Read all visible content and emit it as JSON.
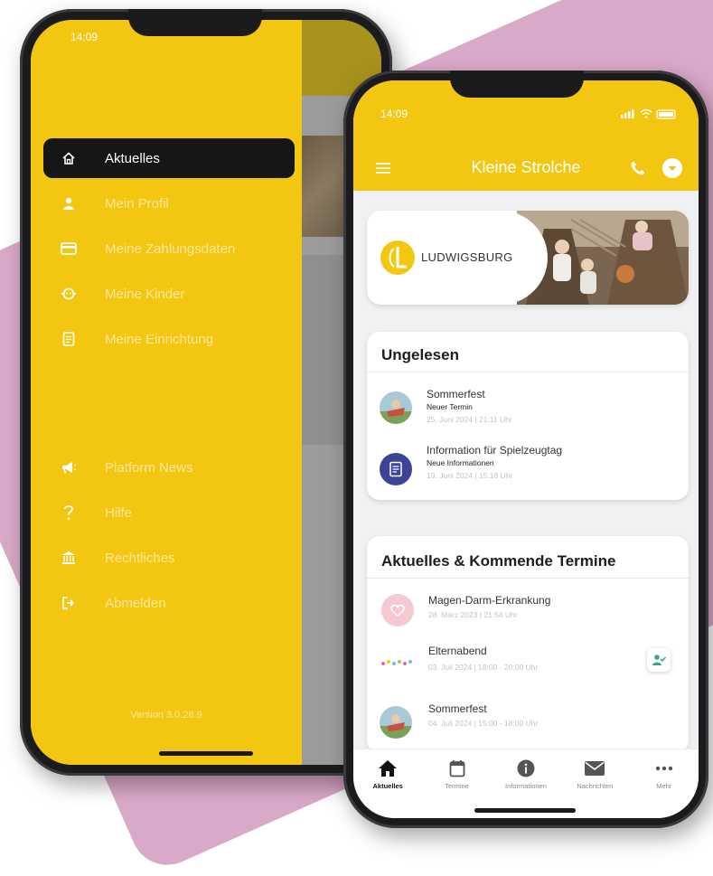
{
  "back_phone": {
    "status_time": "14:09",
    "drawer_items": [
      {
        "label": "Aktuelles",
        "icon": "home-icon",
        "active": true
      },
      {
        "label": "Mein Profil",
        "icon": "person-icon"
      },
      {
        "label": "Meine Zahlungsdaten",
        "icon": "credit-card-icon"
      },
      {
        "label": "Meine Kinder",
        "icon": "child-icon"
      },
      {
        "label": "Meine Einrichtung",
        "icon": "document-icon"
      }
    ],
    "drawer_secondary_items": [
      {
        "label": "Platform News",
        "icon": "megaphone-icon"
      },
      {
        "label": "Hilfe",
        "icon": "question-icon"
      },
      {
        "label": "Rechtliches",
        "icon": "bank-icon"
      },
      {
        "label": "Abmelden",
        "icon": "logout-icon"
      }
    ],
    "version": "Version 3.0.28.9"
  },
  "front_phone": {
    "status_time": "14:09",
    "app_title": "Kleine Strolche",
    "banner_logo_text": "LUDWIGSBURG",
    "unread": {
      "title": "Ungelesen",
      "items": [
        {
          "title": "Sommerfest",
          "subtitle": "Neuer Termin",
          "date": "25. Juni 2024 | 21:11 Uhr"
        },
        {
          "title": "Information für Spielzeugtag",
          "subtitle": "Neue Informationen",
          "date": "19. Juni 2024 | 15:18 Uhr"
        }
      ]
    },
    "upcoming": {
      "title": "Aktuelles & Kommende Termine",
      "items": [
        {
          "title": "Magen-Darm-Erkrankung",
          "date": "28. März 2023 | 21:54 Uhr"
        },
        {
          "title": "Elternabend",
          "date": "03. Juli 2024 | 18:00 - 20:00 Uhr"
        },
        {
          "title": "Sommerfest",
          "date": "04. Juli 2024 | 15:00 - 18:00 Uhr"
        }
      ]
    },
    "bottom_nav": [
      {
        "label": "Aktuelles",
        "icon": "home-icon",
        "active": true
      },
      {
        "label": "Termine",
        "icon": "calendar-icon"
      },
      {
        "label": "Informationen",
        "icon": "info-icon"
      },
      {
        "label": "Nachrichten",
        "icon": "mail-icon"
      },
      {
        "label": "Mehr",
        "icon": "more-icon"
      }
    ]
  },
  "colors": {
    "brand_yellow": "#f3c711",
    "background_blob": "#d9a9c9",
    "active_drawer_item": "#161616"
  }
}
